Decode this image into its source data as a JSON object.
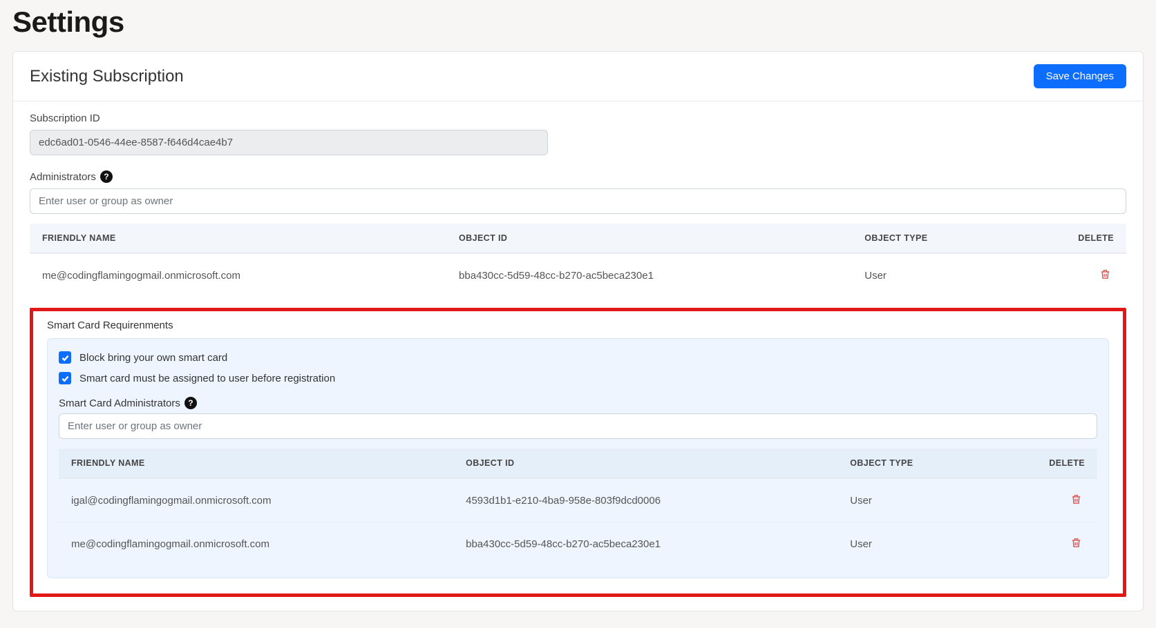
{
  "page_title": "Settings",
  "card": {
    "title": "Existing Subscription",
    "save_button": "Save Changes"
  },
  "subscription": {
    "label": "Subscription ID",
    "value": "edc6ad01-0546-44ee-8587-f646d4cae4b7"
  },
  "administrators": {
    "label": "Administrators",
    "input_placeholder": "Enter user or group as owner",
    "columns": {
      "friendly": "Friendly Name",
      "objectid": "Object ID",
      "objecttype": "Object Type",
      "delete": "Delete"
    },
    "rows": [
      {
        "name": "me@codingflamingogmail.onmicrosoft.com",
        "id": "bba430cc-5d59-48cc-b270-ac5beca230e1",
        "type": "User"
      }
    ]
  },
  "smartcard": {
    "section_title": "Smart Card Requirenments",
    "check1": "Block bring your own smart card",
    "check2": "Smart card must be assigned to user before registration",
    "admins_label": "Smart Card Administrators",
    "input_placeholder": "Enter user or group as owner",
    "columns": {
      "friendly": "Friendly Name",
      "objectid": "Object ID",
      "objecttype": "Object Type",
      "delete": "Delete"
    },
    "rows": [
      {
        "name": "igal@codingflamingogmail.onmicrosoft.com",
        "id": "4593d1b1-e210-4ba9-958e-803f9dcd0006",
        "type": "User"
      },
      {
        "name": "me@codingflamingogmail.onmicrosoft.com",
        "id": "bba430cc-5d59-48cc-b270-ac5beca230e1",
        "type": "User"
      }
    ]
  }
}
